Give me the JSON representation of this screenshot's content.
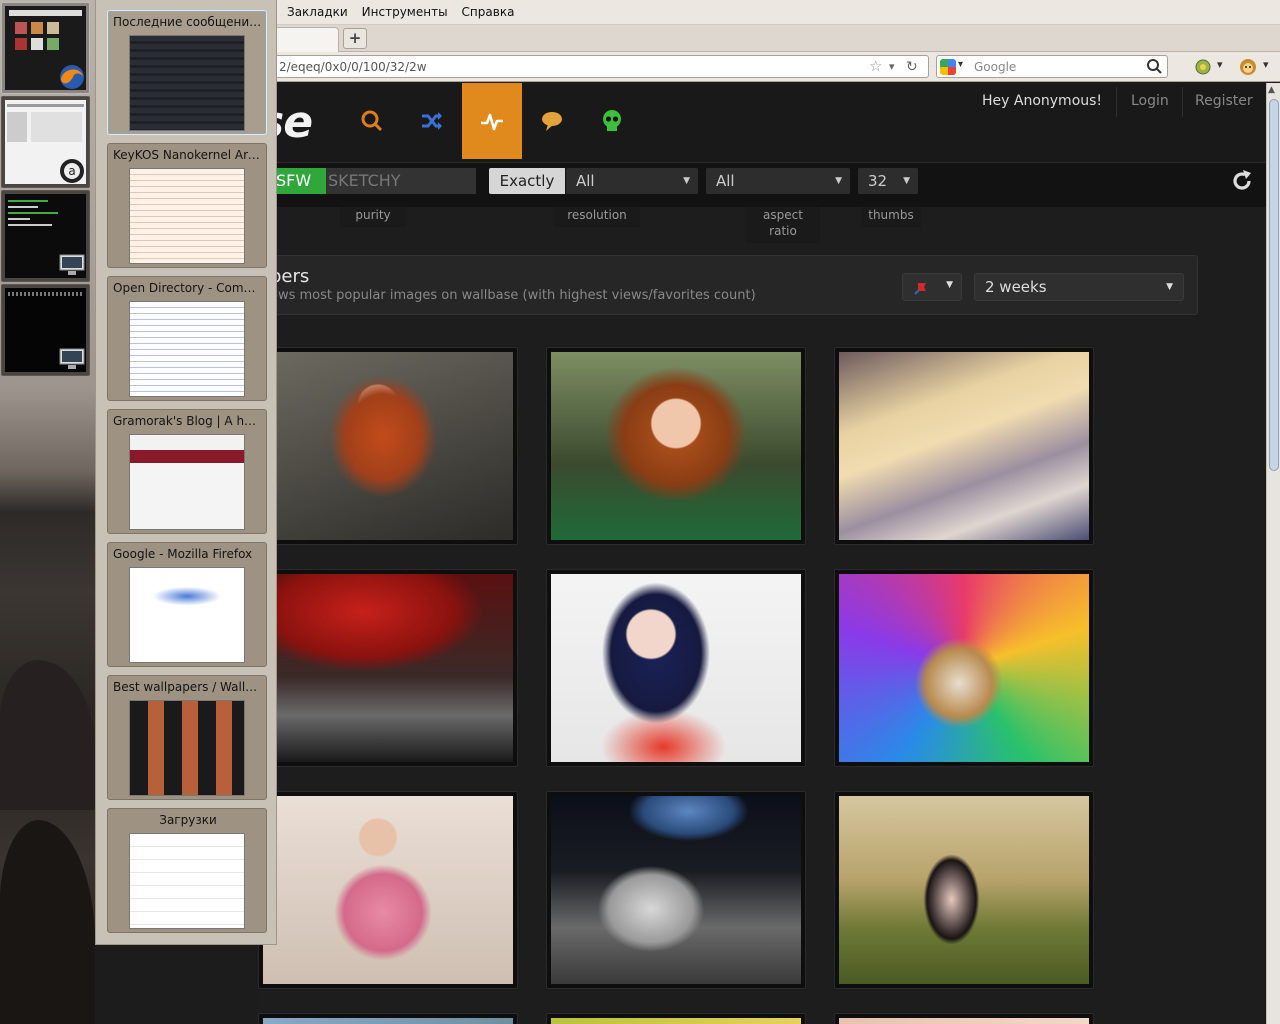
{
  "window_switcher": {
    "items": [
      {
        "name": "firefox-window"
      },
      {
        "name": "amarok-window"
      },
      {
        "name": "terminal-window-1"
      },
      {
        "name": "terminal-window-2"
      }
    ]
  },
  "browser": {
    "menu": [
      "Закладки",
      "Инструменты",
      "Справка"
    ],
    "new_tab_label": "+",
    "url": "2/eqeq/0x0/0/100/32/2w",
    "search": {
      "placeholder": "Google"
    }
  },
  "tab_list": [
    {
      "title": "Последние сообщения - ...",
      "selected": true
    },
    {
      "title": "KeyKOS Nanokernel Arch..."
    },
    {
      "title": "Open Directory - Comput..."
    },
    {
      "title": "Gramorak's Blog | A have..."
    },
    {
      "title": "Google - Mozilla Firefox"
    },
    {
      "title": "Best wallpapers / Wallba..."
    },
    {
      "title": "Загрузки"
    }
  ],
  "site": {
    "logo": "se",
    "greeting": "Hey Anonymous!",
    "login": "Login",
    "register": "Register",
    "nav_icons": [
      "search-icon",
      "random-icon",
      "toplist-icon",
      "chat-icon",
      "skull-icon"
    ],
    "active_nav": "toplist-icon",
    "filters": {
      "purity_sfw": "SFW",
      "purity_sketchy": "SKETCHY",
      "purity_label": "purity",
      "exactly": "Exactly",
      "resolution_value": "All",
      "resolution_label": "resolution",
      "aspect_value": "All",
      "aspect_label": "aspect ratio",
      "thumbs_value": "32",
      "thumbs_label": "thumbs"
    },
    "section": {
      "title": "pers",
      "description": "ows most popular images on wallbase (with highest views/favorites count)",
      "time_range": "2 weeks"
    },
    "thumbnails": [
      {
        "name": "redhead-girl-wallpaper"
      },
      {
        "name": "curly-redhead-wallpaper"
      },
      {
        "name": "snow-mountains-wallpaper"
      },
      {
        "name": "red-forest-wallpaper"
      },
      {
        "name": "blue-hair-girl-wallpaper"
      },
      {
        "name": "colorful-lion-wallpaper"
      },
      {
        "name": "pink-shirt-girl-wallpaper"
      },
      {
        "name": "astronaut-moon-wallpaper"
      },
      {
        "name": "girl-in-field-wallpaper"
      }
    ]
  }
}
